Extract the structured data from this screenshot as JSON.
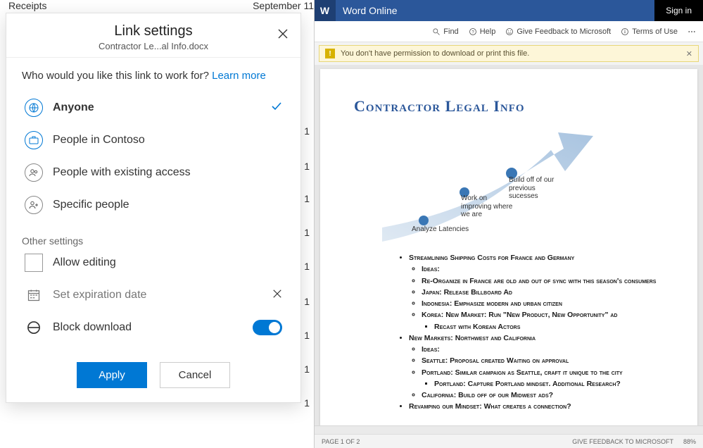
{
  "bg": {
    "header_left": "Receipts",
    "header_right": "September 11",
    "nums": [
      "1",
      "1",
      "1",
      "1",
      "1",
      "1",
      "1",
      "1",
      "1"
    ]
  },
  "dialog": {
    "title": "Link settings",
    "subtitle": "Contractor Le...al Info.docx",
    "who_text": "Who would you like this link to work for?",
    "learn_more": "Learn more",
    "options": [
      {
        "label": "Anyone",
        "selected": true
      },
      {
        "label": "People in Contoso",
        "selected": false
      },
      {
        "label": "People with existing access",
        "selected": false
      },
      {
        "label": "Specific people",
        "selected": false
      }
    ],
    "other_h": "Other settings",
    "allow_edit": "Allow editing",
    "set_exp": "Set expiration date",
    "block_dl": "Block download",
    "apply": "Apply",
    "cancel": "Cancel"
  },
  "word": {
    "app_name": "Word Online",
    "signin": "Sign in",
    "tb": {
      "find": "Find",
      "help": "Help",
      "feedback": "Give Feedback to Microsoft",
      "terms": "Terms of Use"
    },
    "warn": "You don't have permission to download or print this file.",
    "doc_title": "Contractor Legal Info",
    "arrow": {
      "n1": "Analyze Latencies",
      "n2": "Work on improving where we are",
      "n3": "Build off of our previous sucesses"
    },
    "bullets": {
      "a": "Streamlining Shipping Costs for France and Germany",
      "a1": "Ideas:",
      "a2": "Re-Organize in France are old and out of sync with this season's consumers",
      "a3": "Japan: Release  Billboard Ad",
      "a4": "Indonesia: Emphasize modern and urban citizen",
      "a5": "Korea: New Market:  Run \"New Product, New Opportunity\" ad",
      "a5a": "Recast with Korean Actors",
      "b": "New Markets: Northwest and California",
      "b1": "Ideas:",
      "b2": "Seattle: Proposal created Waiting on approval",
      "b3": "Portland: Similar campaign as Seattle, craft it unique to the city",
      "b3a": "Portland: Capture Portland mindset.  Additional Research?",
      "b4": "California:  Build off of our Midwest ads?",
      "c": "Revamping our Mindset:  What creates a connection?"
    },
    "status": {
      "page": "PAGE 1 OF 2",
      "feedback": "GIVE FEEDBACK TO MICROSOFT",
      "zoom": "88%"
    }
  }
}
